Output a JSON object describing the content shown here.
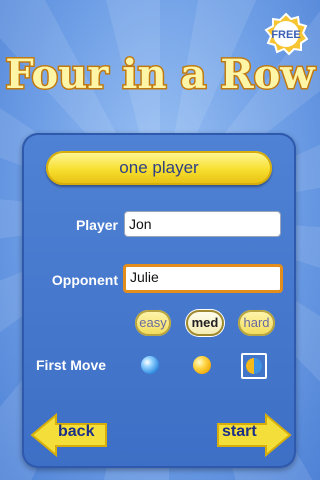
{
  "game_title": "Four in a Row",
  "badge": "FREE",
  "mode_button": "one player",
  "player_label": "Player",
  "player_value": "Jon",
  "opponent_label": "Opponent",
  "opponent_value": "Julie",
  "difficulty": {
    "options": [
      "easy",
      "med",
      "hard"
    ],
    "selected": "med"
  },
  "first_move_label": "First Move",
  "first_move_options": [
    "blue-piece",
    "yellow-piece",
    "random-piece"
  ],
  "first_move_selected": "random-piece",
  "back_label": "back",
  "start_label": "start",
  "colors": {
    "accent_yellow": "#f7df2f",
    "panel_blue": "#4878cf",
    "text_navy": "#2f3f86",
    "field_focus": "#e38d1d"
  }
}
